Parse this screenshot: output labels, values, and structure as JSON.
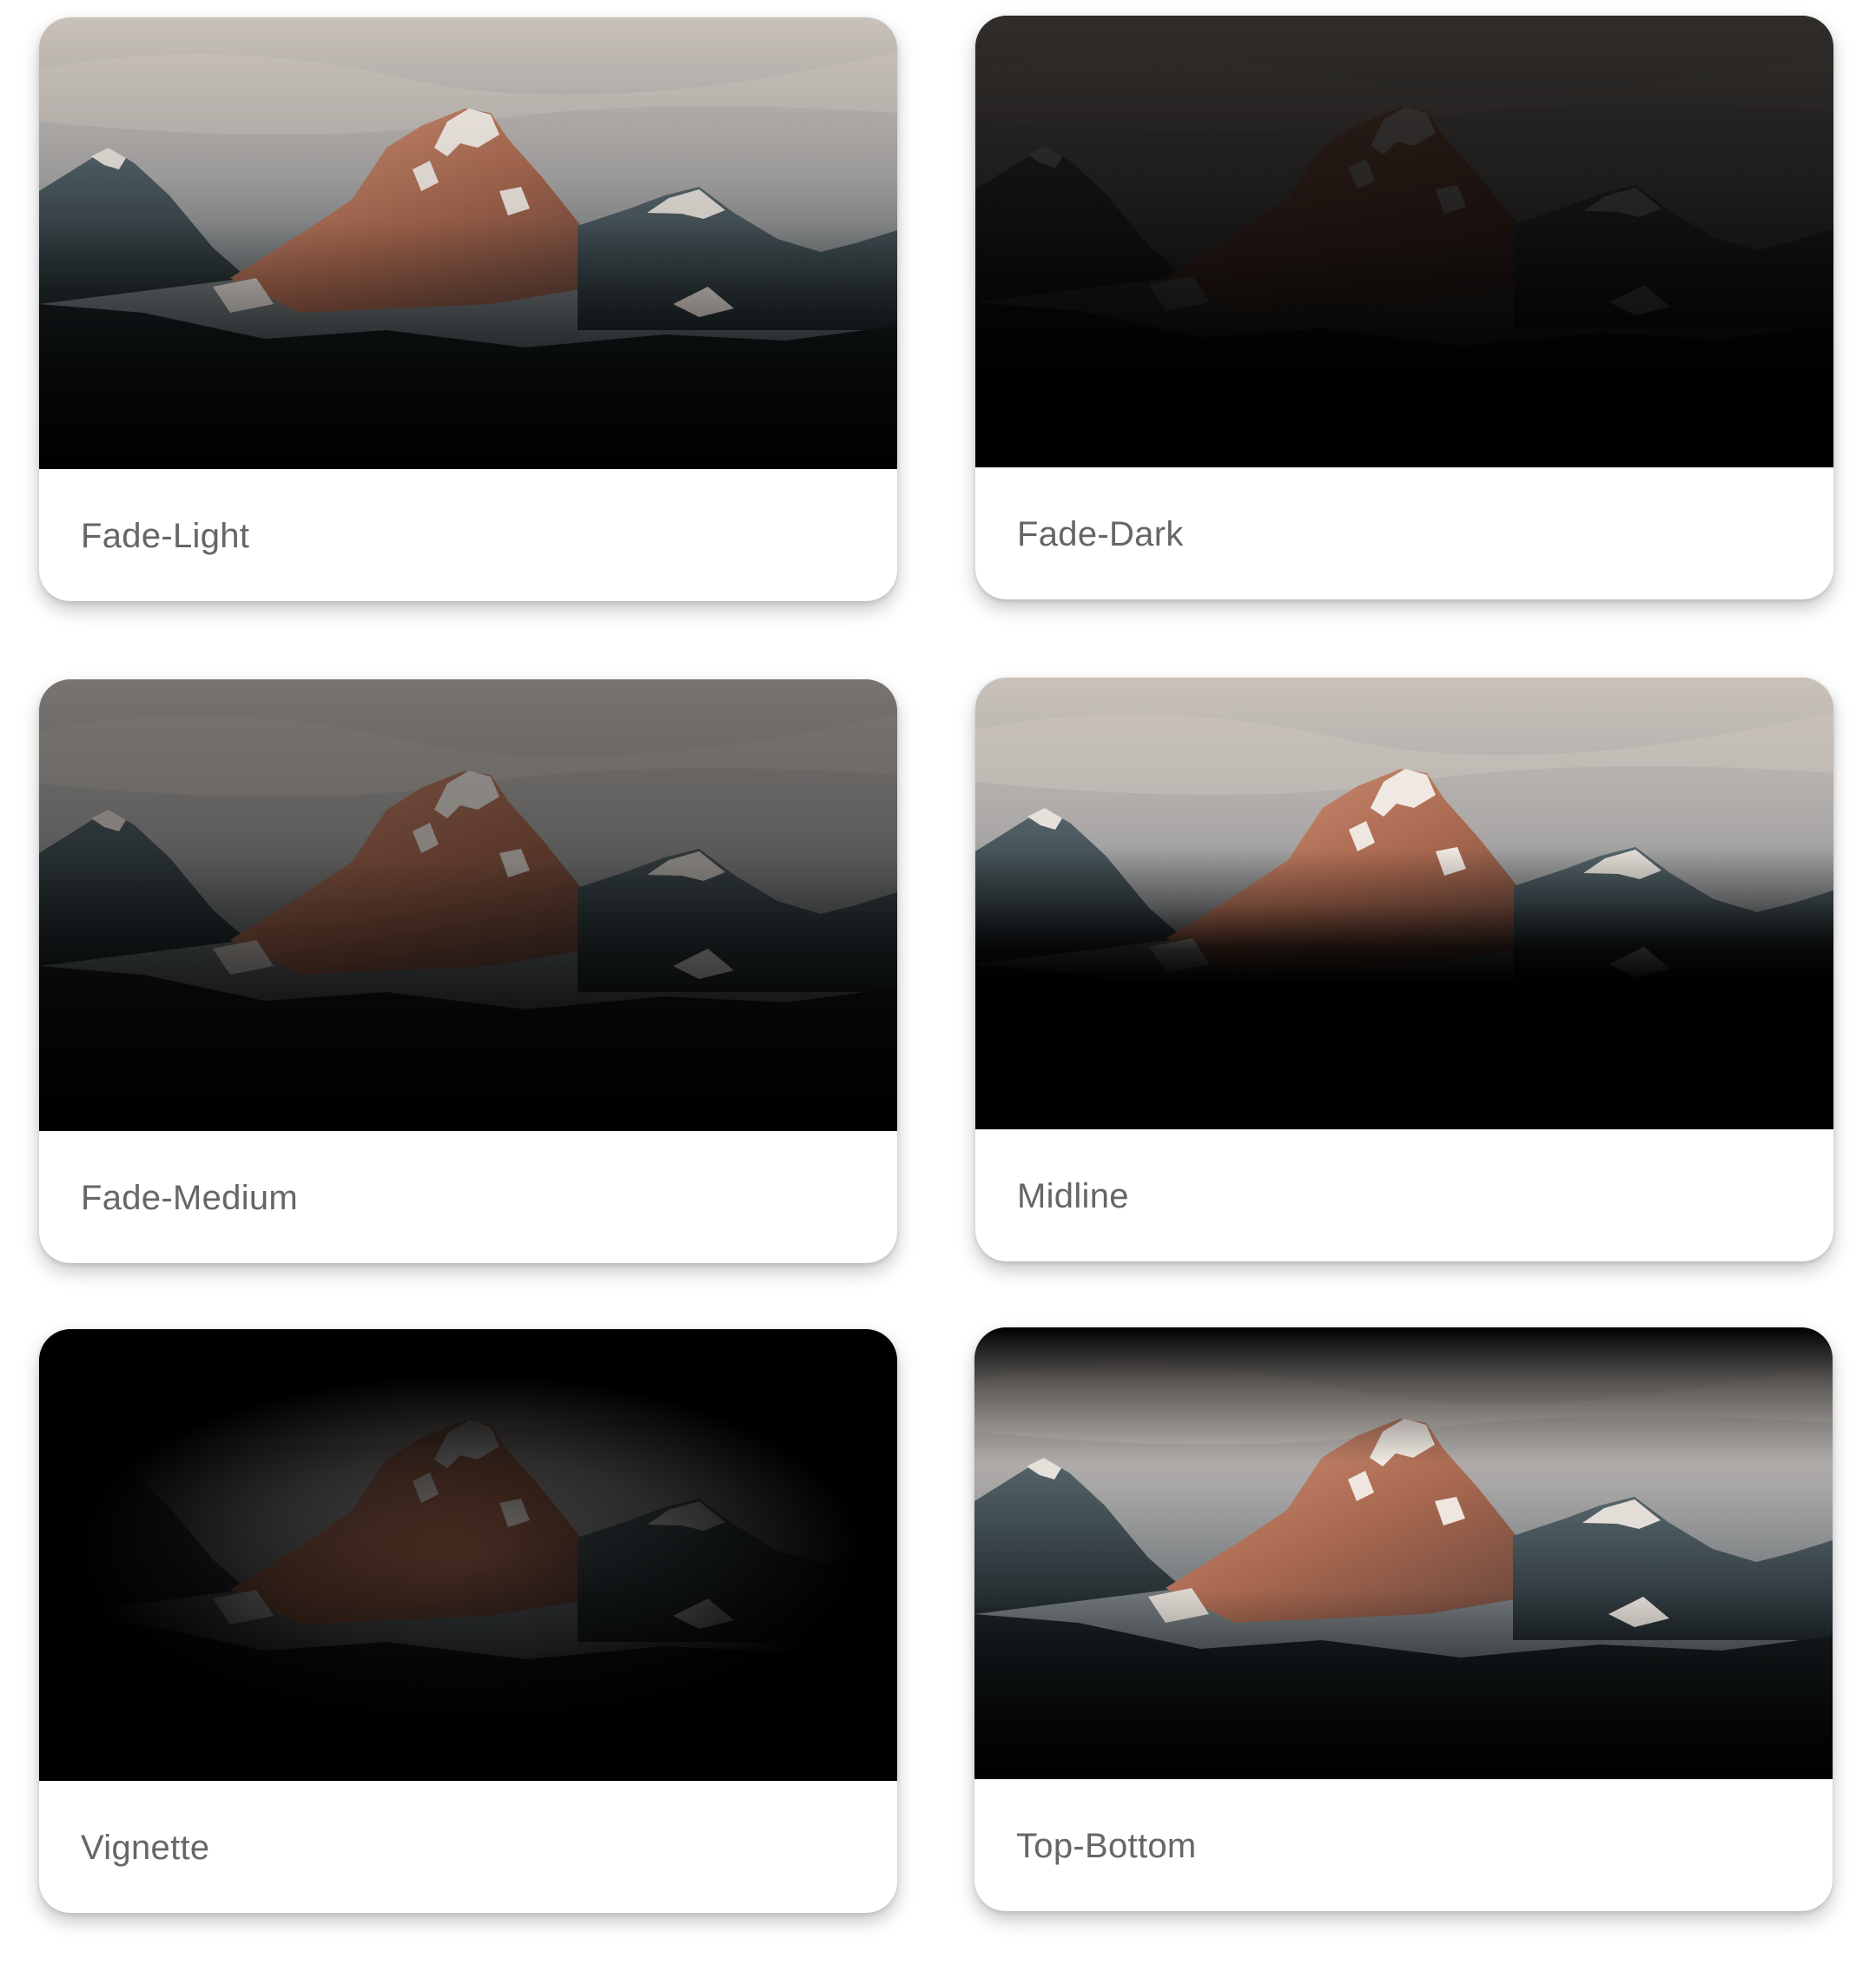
{
  "cards": [
    {
      "label": "Fade-Light",
      "image": "mountain-photo",
      "overlay": "fade-light"
    },
    {
      "label": "Fade-Dark",
      "image": "mountain-photo",
      "overlay": "fade-dark"
    },
    {
      "label": "Fade-Medium",
      "image": "mountain-photo",
      "overlay": "fade-medium"
    },
    {
      "label": "Midline",
      "image": "mountain-photo",
      "overlay": "midline"
    },
    {
      "label": "Vignette",
      "image": "mountain-photo",
      "overlay": "vignette"
    },
    {
      "label": "Top-Bottom",
      "image": "mountain-photo",
      "overlay": "top-bottom"
    }
  ],
  "colors": {
    "card_background": "#ffffff",
    "label_text": "#666666",
    "sky": "#b9b2ac",
    "rock_sunlit": "#b2765a",
    "rock_shadow": "#3a4448",
    "snow": "#e8e2dc"
  }
}
